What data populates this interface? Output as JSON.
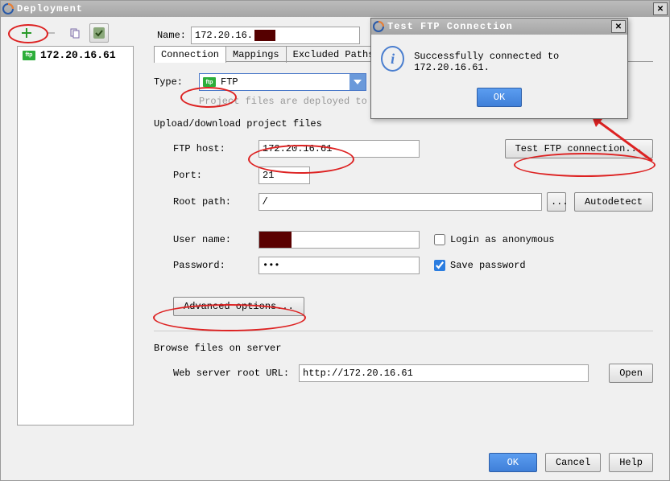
{
  "window": {
    "title": "Deployment"
  },
  "toolbar": {
    "add_icon": "plus",
    "delete_icon": "minus",
    "copy_icon": "copy",
    "use_icon": "check"
  },
  "servers": [
    {
      "label": "172.20.16.61"
    }
  ],
  "name": {
    "label": "Name:",
    "value_prefix": "172.20.16."
  },
  "tabs": [
    {
      "label": "Connection",
      "active": true
    },
    {
      "label": "Mappings",
      "active": false
    },
    {
      "label": "Excluded Paths",
      "active": false
    }
  ],
  "type": {
    "label": "Type:",
    "value": "FTP"
  },
  "hint": "Project files are deployed to a remote",
  "sections": {
    "upload": {
      "title": "Upload/download project files",
      "host_label": "FTP host:",
      "host_value": "172.20.16.61",
      "test_btn": "Test FTP connection...",
      "port_label": "Port:",
      "port_value": "21",
      "root_label": "Root path:",
      "root_value": "/",
      "browse_btn": "...",
      "autodetect_btn": "Autodetect",
      "user_label": "User name:",
      "anon_label": "Login as anonymous",
      "anon_checked": false,
      "pwd_label": "Password:",
      "pwd_value": "•••",
      "save_pwd_label": "Save password",
      "save_pwd_checked": true,
      "advanced_btn": "Advanced options..."
    },
    "browse": {
      "title": "Browse files on server",
      "url_label": "Web server root URL:",
      "url_value": "http://172.20.16.61",
      "open_btn": "Open"
    }
  },
  "buttons": {
    "ok": "OK",
    "cancel": "Cancel",
    "help": "Help"
  },
  "modal": {
    "title": "Test FTP Connection",
    "message": "Successfully connected to 172.20.16.61.",
    "ok": "OK"
  }
}
